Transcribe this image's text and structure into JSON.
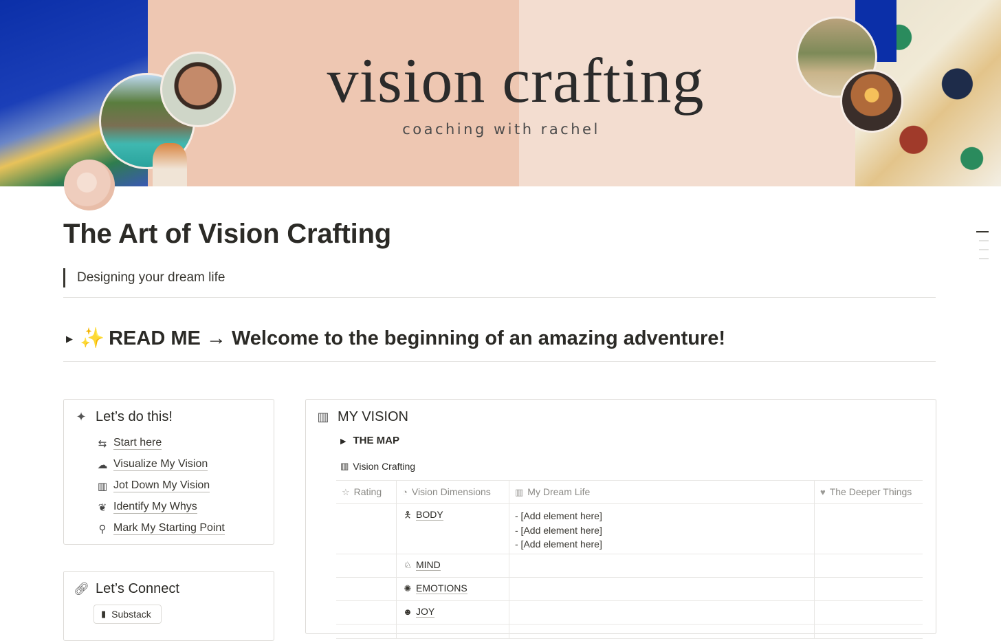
{
  "cover": {
    "title": "vision crafting",
    "subtitle": "coaching with rachel"
  },
  "page": {
    "title": "The Art of Vision Crafting",
    "quote": "Designing your dream life"
  },
  "readme": {
    "emoji": "✨",
    "label": "READ ME → Welcome to the beginning of an amazing adventure!"
  },
  "lets_do_this": {
    "title": "Let’s do this!",
    "items": [
      {
        "icon": "signpost-icon",
        "label": "Start here"
      },
      {
        "icon": "cloud-icon",
        "label": "Visualize My Vision"
      },
      {
        "icon": "map-icon",
        "label": "Jot Down My Vision"
      },
      {
        "icon": "leaf-icon",
        "label": "Identify My Whys"
      },
      {
        "icon": "location-pin-icon",
        "label": "Mark My Starting Point"
      }
    ]
  },
  "lets_connect": {
    "title": "Let’s Connect",
    "chip_label": "Substack"
  },
  "my_vision": {
    "title": "MY VISION",
    "toggle_label": "THE MAP",
    "database_title": "Vision Crafting",
    "columns": [
      "Rating",
      "Vision Dimensions",
      "My Dream Life",
      "The Deeper Things"
    ],
    "rows": [
      {
        "dimension": "BODY",
        "icon": "person-icon",
        "dream": [
          "- [Add element here]",
          "- [Add element here]",
          "- [Add element here]"
        ]
      },
      {
        "dimension": "MIND",
        "icon": "brain-icon",
        "dream": []
      },
      {
        "dimension": "EMOTIONS",
        "icon": "sparkle-burst-icon",
        "dream": []
      },
      {
        "dimension": "JOY",
        "icon": "smile-icon",
        "dream": []
      }
    ]
  }
}
